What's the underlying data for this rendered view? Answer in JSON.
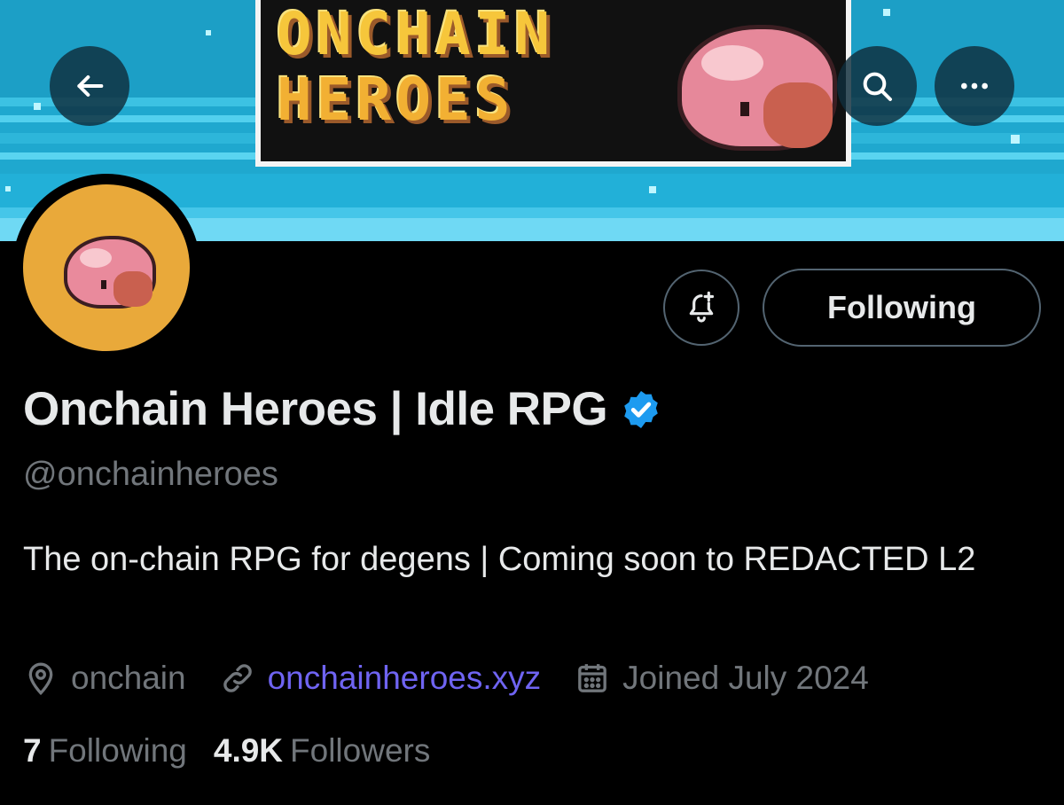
{
  "banner": {
    "logo_line1": "ONCHAIN",
    "logo_line2": "HEROES",
    "back_icon": "arrow-left-icon",
    "search_icon": "search-icon",
    "more_icon": "more-horizontal-icon"
  },
  "actions": {
    "notify_icon": "bell-plus-icon",
    "follow_label": "Following"
  },
  "profile": {
    "display_name": "Onchain Heroes | Idle RPG",
    "verified_icon": "verified-badge-icon",
    "handle": "@onchainheroes",
    "bio": "The on-chain RPG for degens | Coming soon to REDACTED L2",
    "location": "onchain",
    "website": "onchainheroes.xyz",
    "joined": "Joined July 2024"
  },
  "stats": {
    "following_count": "7",
    "following_label": "Following",
    "followers_count": "4.9K",
    "followers_label": "Followers"
  },
  "colors": {
    "background": "#000000",
    "text_primary": "#e7e9ea",
    "text_secondary": "#71767b",
    "link": "#6f64f2",
    "verified": "#1d9bf0",
    "banner_sky": "#1fa8cf",
    "avatar_bg": "#e9a93a"
  }
}
